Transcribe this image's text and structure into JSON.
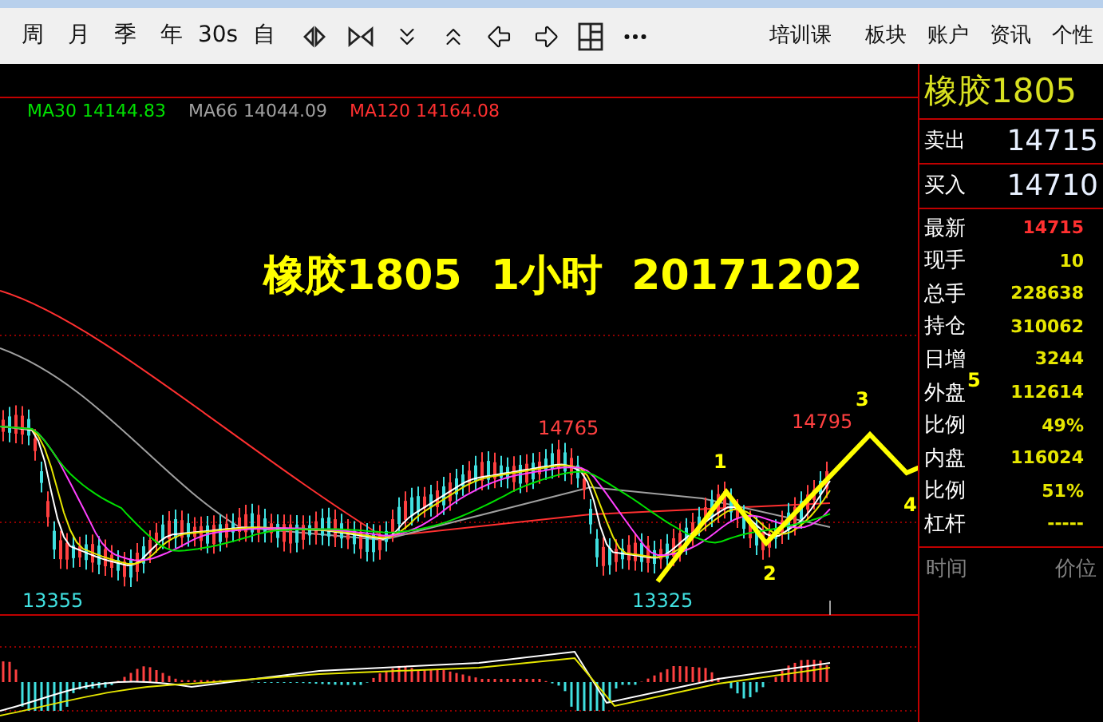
{
  "toolbar": {
    "period_buttons": [
      "周",
      "月",
      "季",
      "年",
      "30s",
      "自"
    ],
    "menu_items": [
      "培训课",
      "板块",
      "账户",
      "资讯",
      "个性"
    ]
  },
  "chart": {
    "legend": [
      {
        "label": "MA30 14144.83",
        "color": "#00e000"
      },
      {
        "label": "MA66 14044.09",
        "color": "#a0a0a0"
      },
      {
        "label": "MA120 14164.08",
        "color": "#ff3030"
      }
    ],
    "title": "橡胶1805  1小时  20171202",
    "price_labels": [
      {
        "text": "14765",
        "kind": "high"
      },
      {
        "text": "14795",
        "kind": "high"
      },
      {
        "text": "13355",
        "kind": "low"
      },
      {
        "text": "13325",
        "kind": "low"
      }
    ],
    "wave_labels": [
      "1",
      "2",
      "3",
      "4",
      "5"
    ]
  },
  "quote": {
    "symbol": "橡胶1805",
    "ask": {
      "label": "卖出",
      "value": "14715"
    },
    "bid": {
      "label": "买入",
      "value": "14710"
    },
    "stats": [
      {
        "label": "最新",
        "value": "14715",
        "color": "#ff3030"
      },
      {
        "label": "现手",
        "value": "10",
        "color": "#e6e600"
      },
      {
        "label": "总手",
        "value": "228638",
        "color": "#e6e600"
      },
      {
        "label": "持仓",
        "value": "310062",
        "color": "#e6e600"
      },
      {
        "label": "日增",
        "value": "3244",
        "color": "#e6e600"
      },
      {
        "label": "外盘",
        "value": "112614",
        "color": "#e6e600"
      },
      {
        "label": "比例",
        "value": "49%",
        "color": "#e6e600"
      },
      {
        "label": "内盘",
        "value": "116024",
        "color": "#e6e600"
      },
      {
        "label": "比例",
        "value": "51%",
        "color": "#e6e600"
      },
      {
        "label": "杠杆",
        "value": "-----",
        "color": "#e6e600"
      }
    ],
    "ticks_header": [
      "时间",
      "价位"
    ]
  }
}
